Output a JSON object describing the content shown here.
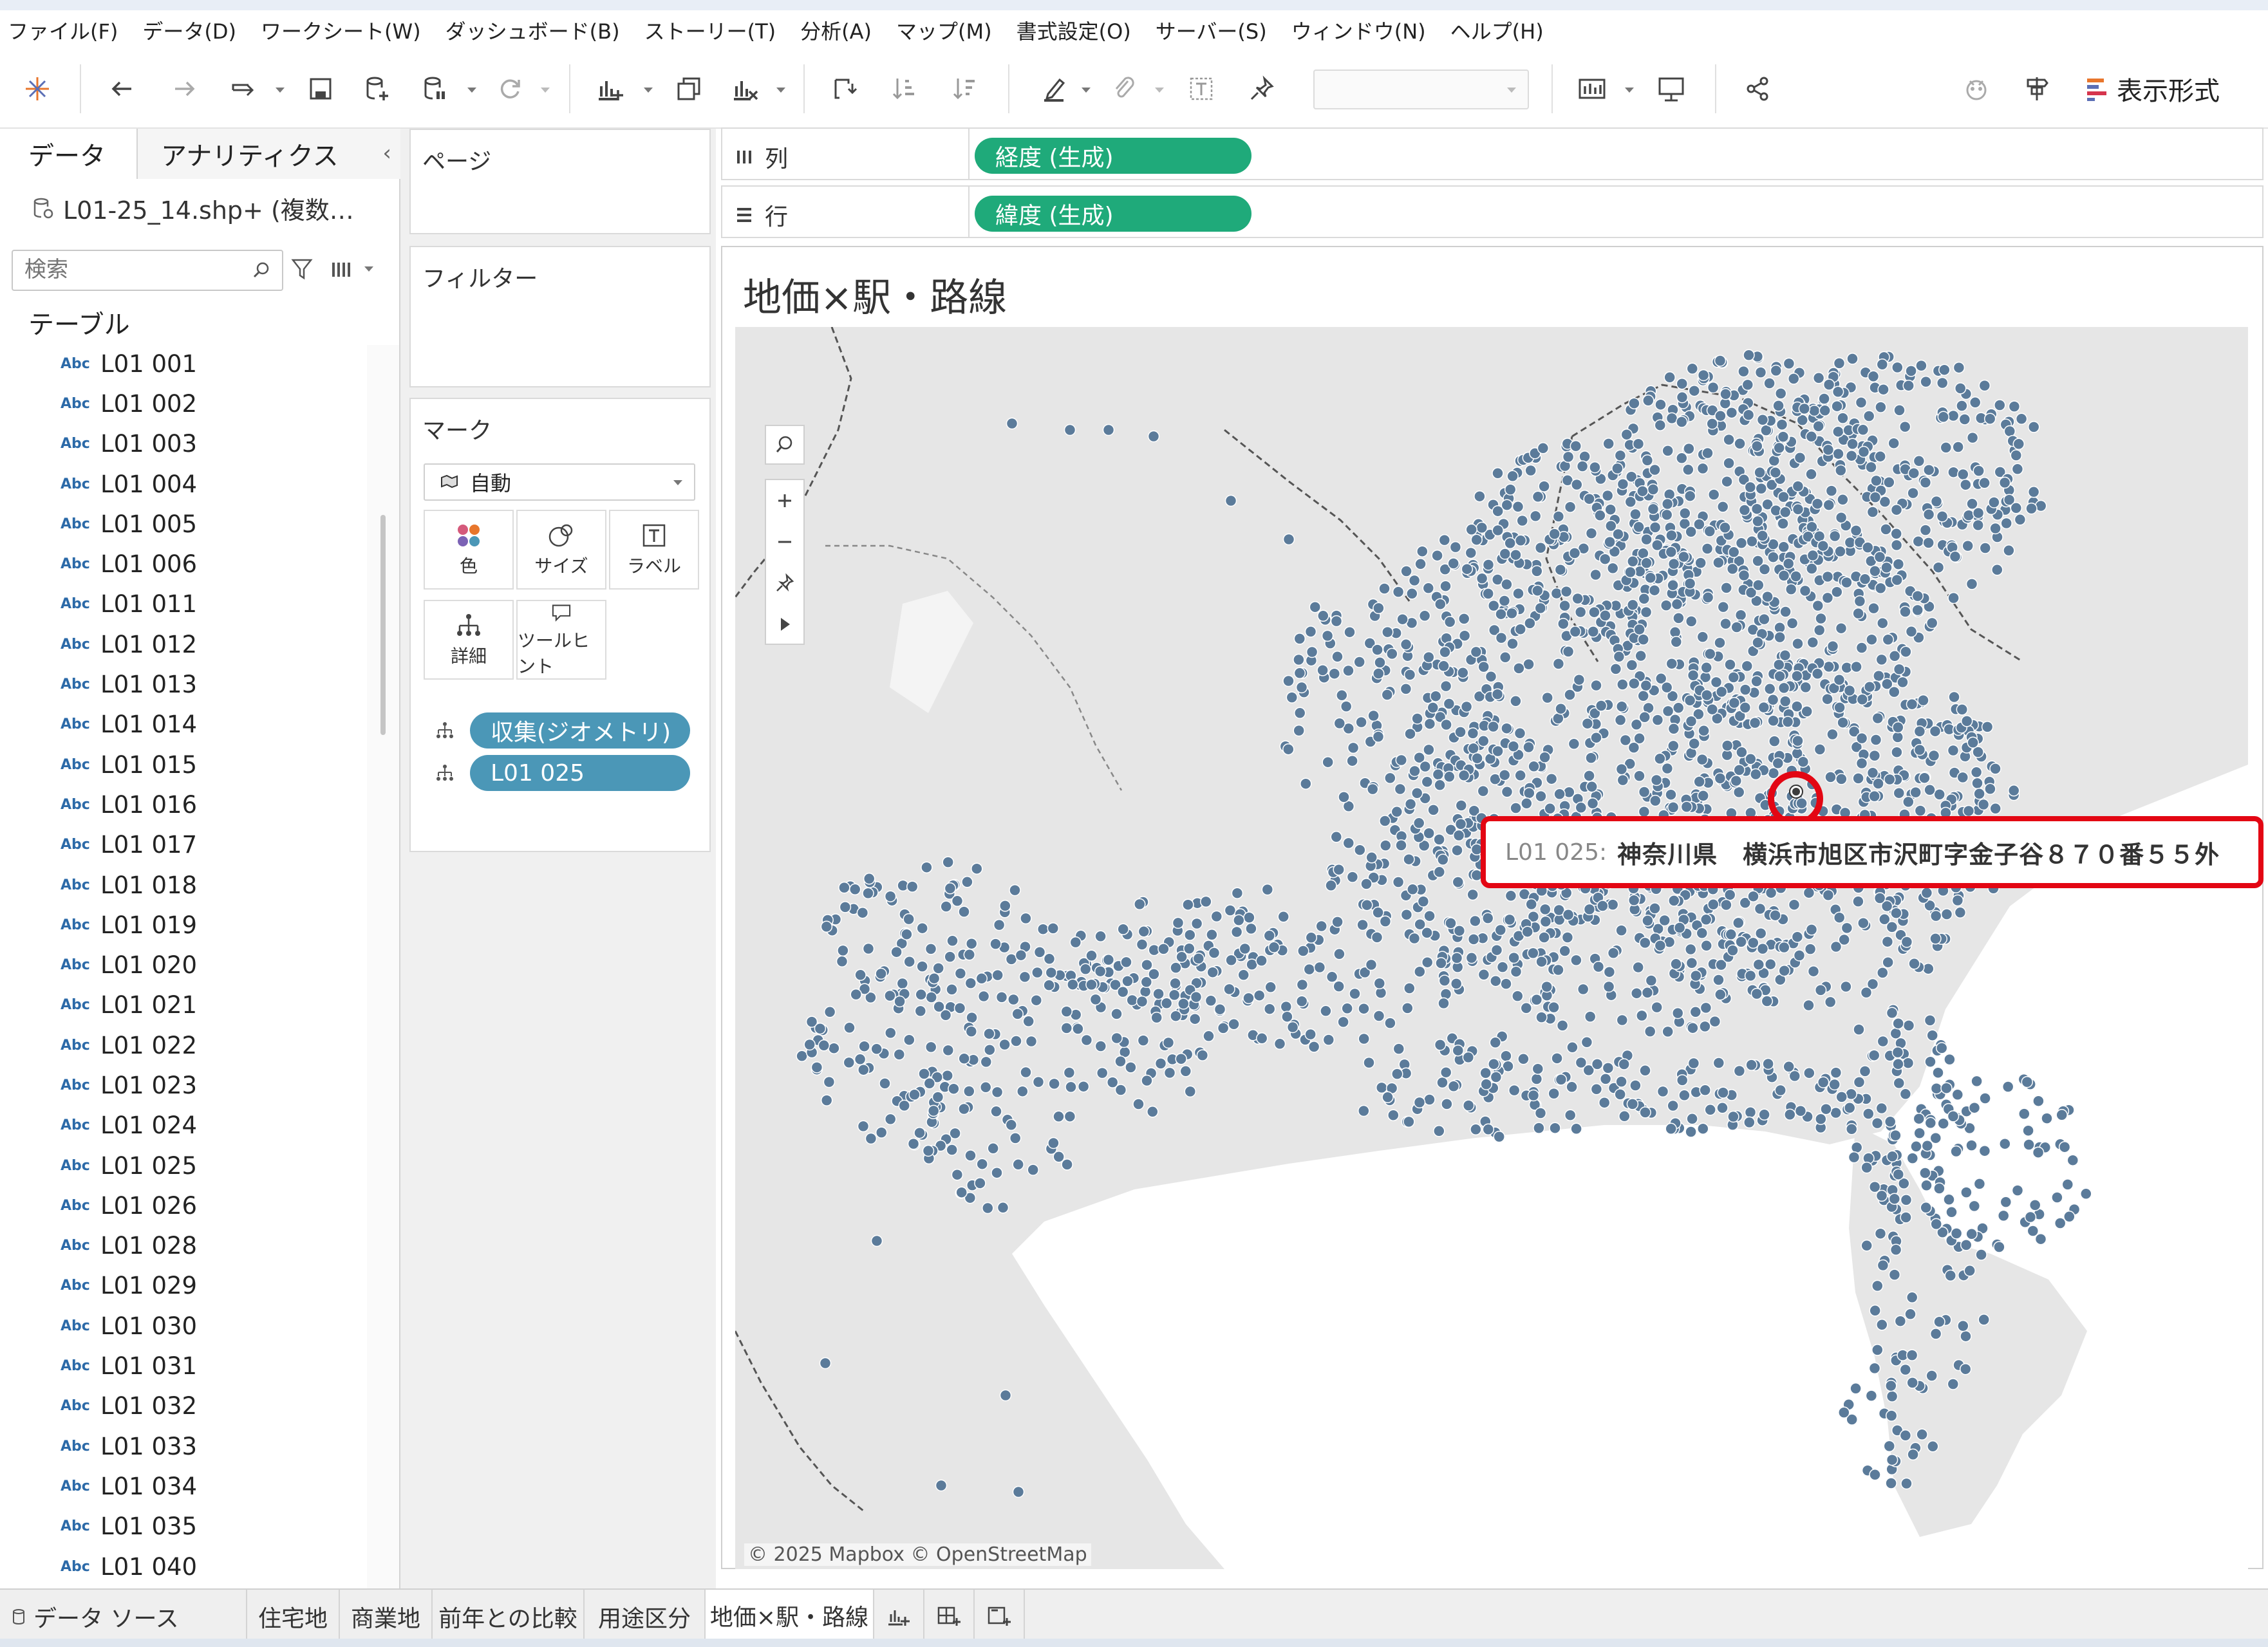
{
  "menu": [
    "ファイル(F)",
    "データ(D)",
    "ワークシート(W)",
    "ダッシュボード(B)",
    "ストーリー(T)",
    "分析(A)",
    "マップ(M)",
    "書式設定(O)",
    "サーバー(S)",
    "ウィンドウ(N)",
    "ヘルプ(H)"
  ],
  "toolbar": {
    "show_me": "表示形式"
  },
  "data_pane": {
    "tabs": {
      "data": "データ",
      "analytics": "アナリティクス"
    },
    "datasource": "L01-25_14.shp+ (複数…",
    "search_placeholder": "検索",
    "tables_header": "テーブル",
    "type_label": "Abc",
    "fields": [
      "L01 001",
      "L01 002",
      "L01 003",
      "L01 004",
      "L01 005",
      "L01 006",
      "L01 011",
      "L01 012",
      "L01 013",
      "L01 014",
      "L01 015",
      "L01 016",
      "L01 017",
      "L01 018",
      "L01 019",
      "L01 020",
      "L01 021",
      "L01 022",
      "L01 023",
      "L01 024",
      "L01 025",
      "L01 026",
      "L01 028",
      "L01 029",
      "L01 030",
      "L01 031",
      "L01 032",
      "L01 033",
      "L01 034",
      "L01 035",
      "L01 040"
    ]
  },
  "cards": {
    "pages": "ページ",
    "filters": "フィルター",
    "marks": {
      "title": "マーク",
      "mark_type": "自動",
      "buttons": {
        "color": "色",
        "size": "サイズ",
        "label": "ラベル",
        "detail": "詳細",
        "tooltip": "ツールヒント"
      },
      "pills": [
        "収集(ジオメトリ)",
        "L01 025"
      ]
    }
  },
  "shelves": {
    "columns": {
      "label": "列",
      "pill": "経度 (生成)"
    },
    "rows": {
      "label": "行",
      "pill": "緯度 (生成)"
    }
  },
  "viz": {
    "title": "地価×駅・路線",
    "attribution": "© 2025 Mapbox © OpenStreetMap",
    "mark_color": "#5b7b9a",
    "tooltip": {
      "key": "L01 025:",
      "value": "神奈川県　横浜市旭区市沢町字金子谷８７０番５５外"
    }
  },
  "bottom_tabs": {
    "datasource": "データ ソース",
    "sheets": [
      "住宅地",
      "商業地",
      "前年との比較",
      "用途区分",
      "地価×駅・路線"
    ],
    "active": "地価×駅・路線"
  },
  "colors": {
    "accent_green": "#1faa7a",
    "pill_blue": "#4b97b7",
    "highlight_red": "#e30613"
  }
}
